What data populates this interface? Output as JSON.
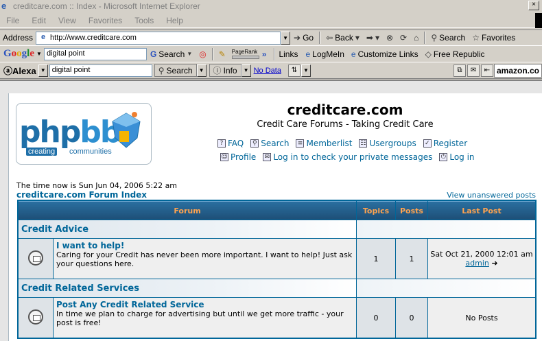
{
  "window": {
    "title": "creditcare.com :: Index - Microsoft Internet Explorer",
    "close_glyph": "×"
  },
  "menu": [
    "File",
    "Edit",
    "View",
    "Favorites",
    "Tools",
    "Help"
  ],
  "address": {
    "label": "Address",
    "url": "http://www.creditcare.com",
    "go": "Go",
    "back": "Back",
    "search": "Search",
    "favorites": "Favorites"
  },
  "google": {
    "query": "digital point",
    "search": "Search",
    "pagerank": "PageRank",
    "chevrons": "»",
    "links": "Links",
    "link_items": [
      "LogMeIn",
      "Customize Links",
      "Free Republic"
    ]
  },
  "alexa": {
    "logo": "Alexa",
    "query": "digital point",
    "search": "Search",
    "info": "Info",
    "nodata": "No Data",
    "amazon": "amazon.co"
  },
  "site": {
    "title": "creditcare.com",
    "description": "Credit Care Forums - Taking Credit Care"
  },
  "logo": {
    "text_php": "php",
    "text_bb": "bb",
    "tag1": "creating",
    "tag2": "communities"
  },
  "nav": {
    "row1": [
      {
        "label": "FAQ",
        "icon": "faq-icon"
      },
      {
        "label": "Search",
        "icon": "search-icon"
      },
      {
        "label": "Memberlist",
        "icon": "memberlist-icon"
      },
      {
        "label": "Usergroups",
        "icon": "usergroups-icon"
      },
      {
        "label": "Register",
        "icon": "register-icon"
      }
    ],
    "row2": [
      {
        "label": "Profile",
        "icon": "profile-icon"
      },
      {
        "label": "Log in to check your private messages",
        "icon": "messages-icon"
      },
      {
        "label": "Log in",
        "icon": "login-icon"
      }
    ]
  },
  "time_now": "The time now is Sun Jun 04, 2006 5:22 am",
  "forum_index": "creditcare.com Forum Index",
  "unanswered": "View unanswered posts",
  "table": {
    "headers": {
      "forum": "Forum",
      "topics": "Topics",
      "posts": "Posts",
      "last_post": "Last Post"
    },
    "categories": [
      {
        "name": "Credit Advice",
        "forum": {
          "name": "I want to help!",
          "description": "Caring for your Credit has never been more important. I want to help! Just ask your questions here.",
          "topics": "1",
          "posts": "1",
          "last_post_date": "Sat Oct 21, 2000 12:01 am",
          "last_post_author": "admin",
          "last_post_arrow": "➜"
        }
      },
      {
        "name": "Credit Related Services",
        "forum": {
          "name": "Post Any Credit Related Service",
          "description": "In time we plan to charge for advertising but until we get more traffic - your post is free!",
          "topics": "0",
          "posts": "0",
          "last_post_text": "No Posts"
        }
      }
    ]
  }
}
